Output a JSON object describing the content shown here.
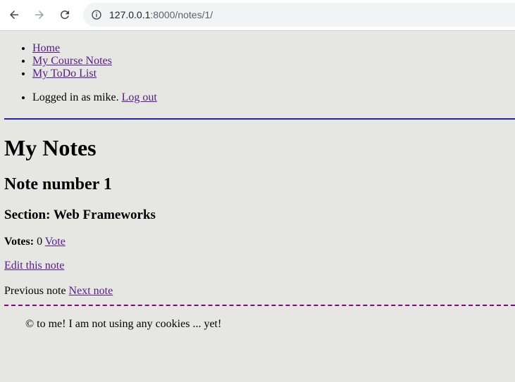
{
  "browser": {
    "url_host": "127.0.0.1",
    "url_path": ":8000/notes/1/"
  },
  "nav": {
    "items": [
      {
        "label": "Home"
      },
      {
        "label": "My Course Notes"
      },
      {
        "label": "My ToDo List"
      }
    ]
  },
  "user": {
    "text": "Logged in as mike. ",
    "logout_label": "Log out"
  },
  "main": {
    "title": "My Notes",
    "note_heading": "Note number 1",
    "section_heading": "Section: Web Frameworks",
    "votes_label": "Votes:",
    "votes_value": " 0 ",
    "vote_link": "Vote",
    "edit_link": "Edit this note",
    "previous_text": "Previous note ",
    "next_link": "Next note"
  },
  "footer": {
    "text": "© to me! I am not using any cookies ... yet!"
  },
  "colors": {
    "link": "#551a8b",
    "top_rule": "#2020c0",
    "bottom_rule": "#8b008b",
    "page_background": "#e6e6e2"
  }
}
